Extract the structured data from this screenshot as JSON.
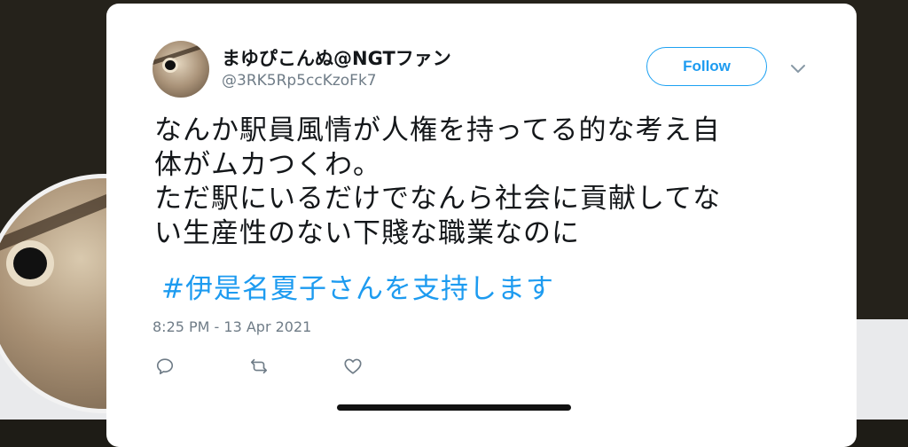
{
  "tweet": {
    "display_name": "まゆぴこんぬ@NGTファン",
    "handle": "@3RK5Rp5ccKzoFk7",
    "follow_label": "Follow",
    "text_lines": [
      "なんか駅員風情が人権を持ってる的な考え自",
      "体がムカつくわ。",
      "ただ駅にいるだけでなんら社会に貢献してな",
      "い生産性のない下賤な職業なのに"
    ],
    "hashtag": "#伊是名夏子さんを支持します",
    "timestamp": "8:25 PM - 13 Apr 2021"
  },
  "icons": {
    "avatar": "squirrel-avatar",
    "more": "chevron-down-icon",
    "reply": "reply-icon",
    "retweet": "retweet-icon",
    "like": "heart-icon"
  },
  "colors": {
    "accent": "#1d9bf0",
    "text": "#14171a",
    "muted": "#6f7c87",
    "card": "#ffffff",
    "background": "#25221b"
  }
}
